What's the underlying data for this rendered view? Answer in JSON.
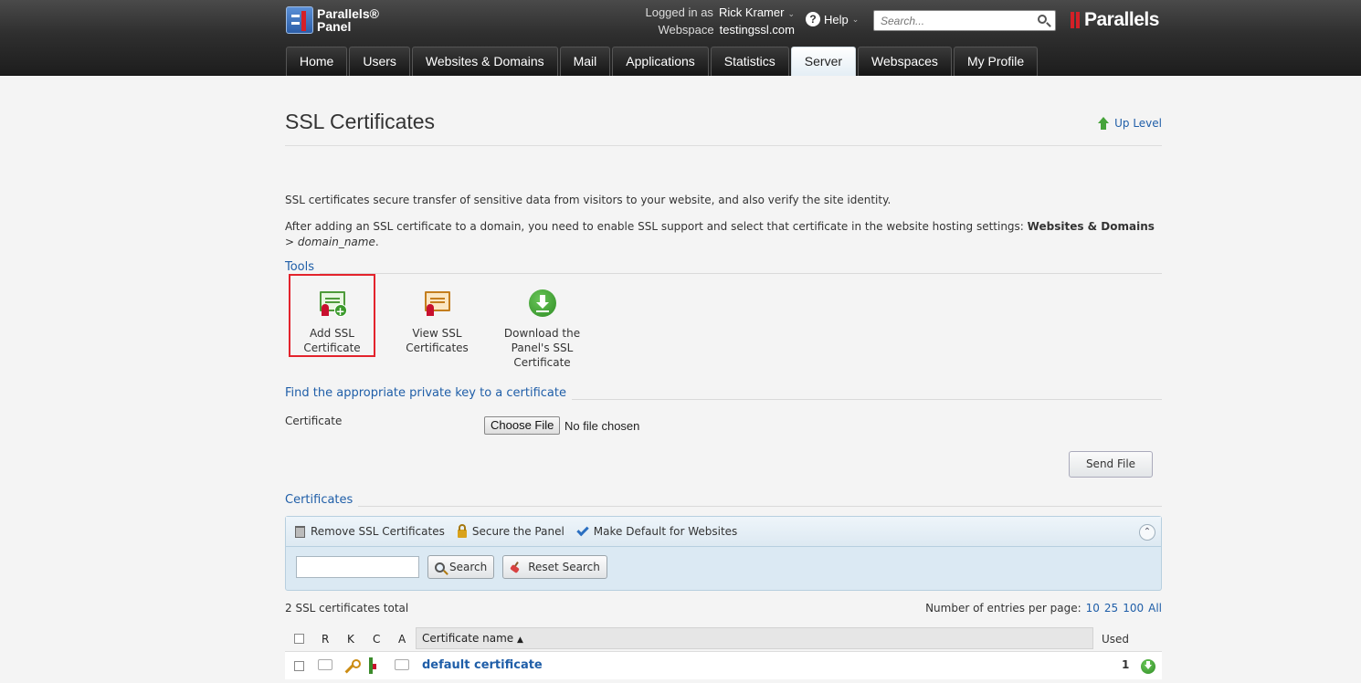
{
  "header": {
    "logo_line1": "Parallels®",
    "logo_line2": "Panel",
    "logged_in_label": "Logged in as",
    "user_name": "Rick Kramer",
    "webspace_label": "Webspace",
    "webspace_value": "testingssl.com",
    "help_label": "Help",
    "search_placeholder": "Search...",
    "brand": "Parallels"
  },
  "nav": {
    "tabs": [
      {
        "label": "Home"
      },
      {
        "label": "Users"
      },
      {
        "label": "Websites & Domains"
      },
      {
        "label": "Mail"
      },
      {
        "label": "Applications"
      },
      {
        "label": "Statistics"
      },
      {
        "label": "Server"
      },
      {
        "label": "Webspaces"
      },
      {
        "label": "My Profile"
      }
    ],
    "active": "Server"
  },
  "page": {
    "title": "SSL Certificates",
    "up_level": "Up Level",
    "desc1": "SSL certificates secure transfer of sensitive data from visitors to your website, and also verify the site identity.",
    "desc2_prefix": "After adding an SSL certificate to a domain, you need to enable SSL support and select that certificate in the website hosting settings: ",
    "desc2_bold": "Websites & Domains",
    "desc2_sep": " > ",
    "desc2_italic": "domain_name",
    "desc2_end": "."
  },
  "tools": {
    "section": "Tools",
    "items": [
      {
        "line1": "Add SSL",
        "line2": "Certificate",
        "line3": ""
      },
      {
        "line1": "View SSL",
        "line2": "Certificates",
        "line3": ""
      },
      {
        "line1": "Download the",
        "line2": "Panel's SSL",
        "line3": "Certificate"
      }
    ]
  },
  "find_key": {
    "section": "Find the appropriate private key to a certificate",
    "field_label": "Certificate",
    "choose_file": "Choose File",
    "file_status": "No file chosen",
    "send_file": "Send File"
  },
  "certificates": {
    "section": "Certificates",
    "toolbar": {
      "remove": "Remove SSL Certificates",
      "secure": "Secure the Panel",
      "make_default": "Make Default for Websites"
    },
    "search_button": "Search",
    "reset_button": "Reset Search",
    "total": "2 SSL certificates total",
    "per_page_label": "Number of entries per page:",
    "per_page_options": [
      "10",
      "25",
      "100",
      "All"
    ],
    "columns": {
      "r": "R",
      "k": "K",
      "c": "C",
      "a": "A",
      "name": "Certificate name",
      "sort_arrow": "▲",
      "used": "Used"
    },
    "rows": [
      {
        "name": "default certificate",
        "used": "1"
      }
    ]
  }
}
